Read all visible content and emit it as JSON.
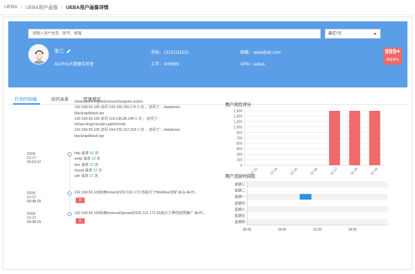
{
  "breadcrumb": [
    "UEBA",
    "UEBA用户画像",
    "UEBA用户画像详情"
  ],
  "search": {
    "placeholder": "请输入用户信息、账号、邮箱"
  },
  "range_select": {
    "value": "最近7天"
  },
  "profile": {
    "name": "张三",
    "org": "AILPHA大数据实验室",
    "phone_label": "手机：",
    "phone": "13122111021",
    "empno_label": "工号：",
    "empno": "AH9999",
    "email_label": "邮箱：",
    "email": "ueba@ah.com",
    "vpn_label": "VPN：",
    "vpn": "ueba1"
  },
  "risk_badge": {
    "value": "999+",
    "label": "风险评分"
  },
  "tabs": [
    "行为时间轴",
    "访问关系",
    "登录地区"
  ],
  "timeline": {
    "block1": [
      {
        "pre": "showcase/integration/saveGangster.action"
      },
      {
        "pre": "192.168.56.105 访问 193.166.255.170 ",
        "count": "8",
        "post": " 次 ，访问了：/databrain-"
      },
      {
        "pre": "black/api/black-ips"
      },
      {
        "pre": "192.168.56.105 访问 119.196.86.246 ",
        "count": "6",
        "post": " 次 ，访问了："
      },
      {
        "pre": "/ethan.feng/cloudsrv.git/info/refs"
      },
      {
        "pre": "192.168.56.105 访问 164.239.157.218 ",
        "count": "4",
        "post": " 次 ，访问了：/databrain-"
      },
      {
        "pre": "black/api/black-ips"
      }
    ],
    "entry2": {
      "time": "2018-12-17 09:53:37",
      "lines": [
        {
          "pre": "http 请求 ",
          "count": "55",
          "post": " 次"
        },
        {
          "pre": "smtp 请求 ",
          "count": "33",
          "post": " 次"
        },
        {
          "pre": "dns 请求 ",
          "count": "22",
          "post": " 次"
        },
        {
          "pre": "mysql 请求 ",
          "count": "22",
          "post": " 次"
        },
        {
          "pre": "ssh 请求 ",
          "count": "22",
          "post": " 次"
        }
      ]
    },
    "entry3": {
      "time": "2018-12-17 09:48:29",
      "text": "192.168.56.105利用miner对202.101.172.35执行了NtsMiner挖矿木马 AHTI。",
      "badge": "5"
    },
    "entry4": {
      "time": "2018-12-17 09:48:29",
      "text": "192.168.56.105利用immoralSpread对202.101.172.35执行了弄性的同推广 AHTI。",
      "badge": "5"
    }
  },
  "risk_chart_title": "用户风险评分",
  "activity_chart_title": "用户活跃时间段",
  "chart_data": [
    {
      "type": "bar",
      "title": "用户风险评分",
      "categories": [
        "12-13",
        "12-14",
        "12-15",
        "12-16",
        "12-17",
        "12-18",
        "12-19"
      ],
      "values": [
        0,
        0,
        0,
        0,
        1500,
        1500,
        1500
      ],
      "ylim": [
        0,
        1500
      ],
      "yticks": [
        "0",
        "150",
        "300",
        "450",
        "600",
        "750",
        "900",
        "1,050",
        "1,200",
        "1,350",
        "1,500"
      ],
      "color": "#f06a6a",
      "grid": true
    },
    {
      "type": "heatmap",
      "title": "用户活跃时间段",
      "rows": [
        "星期三",
        "星期二",
        "星期一",
        "星期日",
        "星期六",
        "星期五",
        "星期四"
      ],
      "xticks": [
        "00:00",
        "06:00",
        "12:00",
        "18:00"
      ],
      "xlim": [
        0,
        24
      ],
      "cells": [
        {
          "row": "星期一",
          "hour": 9,
          "value": 1
        }
      ],
      "color": "#2d8fe2"
    }
  ]
}
